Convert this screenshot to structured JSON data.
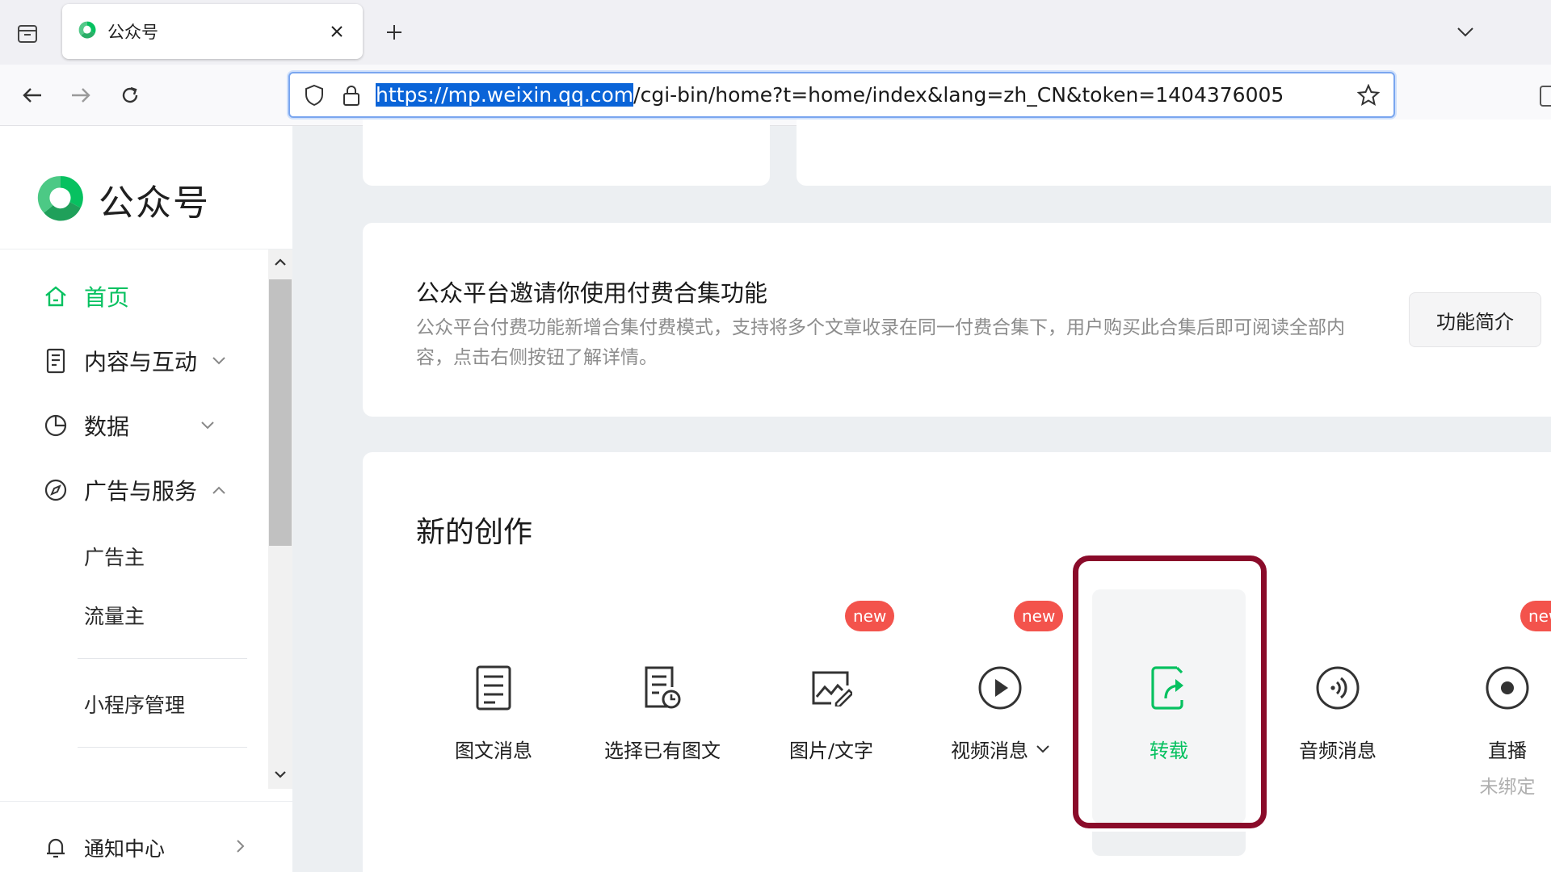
{
  "browser": {
    "tab_title": "公众号",
    "url_highlighted": "https://mp.weixin.qq.com",
    "url_rest": "/cgi-bin/home?t=home/index&lang=zh_CN&token=1404376005"
  },
  "sidebar": {
    "logo_text": "公众号",
    "items": [
      {
        "label": "首页",
        "icon": "home-icon",
        "active": true
      },
      {
        "label": "内容与互动",
        "icon": "document-icon",
        "expandable": true,
        "expanded": false
      },
      {
        "label": "数据",
        "icon": "pie-chart-icon",
        "expandable": true,
        "expanded": false
      },
      {
        "label": "广告与服务",
        "icon": "compass-icon",
        "expandable": true,
        "expanded": true
      }
    ],
    "sub_items": [
      "广告主",
      "流量主",
      "小程序管理"
    ],
    "notification": "通知中心"
  },
  "promo": {
    "title": "公众平台邀请你使用付费合集功能",
    "description": "公众平台付费功能新增合集付费模式，支持将多个文章收录在同一付费合集下，用户购买此合集后即可阅读全部内容，点击右侧按钮了解详情。",
    "button": "功能简介"
  },
  "create": {
    "title": "新的创作",
    "items": [
      {
        "label": "图文消息",
        "icon": "article-icon"
      },
      {
        "label": "选择已有图文",
        "icon": "existing-article-icon"
      },
      {
        "label": "图片/文字",
        "icon": "image-text-icon",
        "badge": "new"
      },
      {
        "label": "视频消息",
        "icon": "video-play-icon",
        "badge": "new",
        "dropdown": true
      },
      {
        "label": "转载",
        "icon": "repost-icon",
        "highlighted": true
      },
      {
        "label": "音频消息",
        "icon": "audio-icon"
      },
      {
        "label": "直播",
        "icon": "live-icon",
        "badge": "new",
        "sub": "未绑定"
      }
    ]
  },
  "colors": {
    "accent_green": "#07c160",
    "badge_red": "#f3534c",
    "highlight_frame": "#8a0b2a",
    "url_selection": "#0a64d8"
  }
}
